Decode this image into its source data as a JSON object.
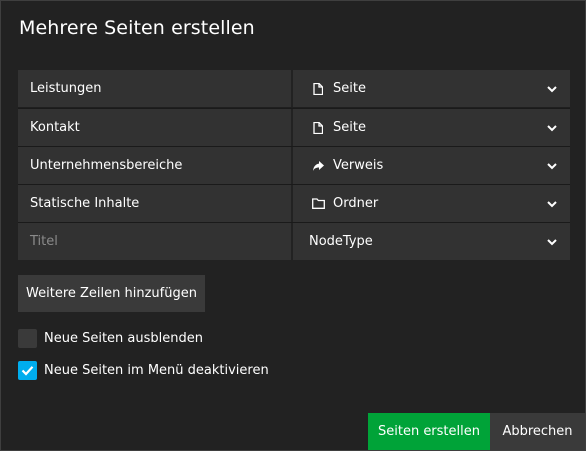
{
  "dialog": {
    "title": "Mehrere Seiten erstellen"
  },
  "rows": [
    {
      "title": "Leistungen",
      "type": "Seite",
      "icon": "document-icon"
    },
    {
      "title": "Kontakt",
      "type": "Seite",
      "icon": "document-icon"
    },
    {
      "title": "Unternehmensbereiche",
      "type": "Verweis",
      "icon": "share-arrow-icon"
    },
    {
      "title": "Statische Inhalte",
      "type": "Ordner",
      "icon": "folder-icon"
    },
    {
      "title_placeholder": "Titel",
      "type_placeholder": "NodeType"
    }
  ],
  "add_rows_label": "Weitere Zeilen hinzufügen",
  "checkboxes": [
    {
      "label": "Neue Seiten ausblenden",
      "checked": false
    },
    {
      "label": "Neue Seiten im Menü deaktivieren",
      "checked": true
    }
  ],
  "footer": {
    "create_label": "Seiten erstellen",
    "cancel_label": "Abbrechen"
  },
  "colors": {
    "accent_green": "#00a338",
    "checkbox_blue": "#00adee",
    "background": "#222222",
    "row_background": "#323232"
  }
}
